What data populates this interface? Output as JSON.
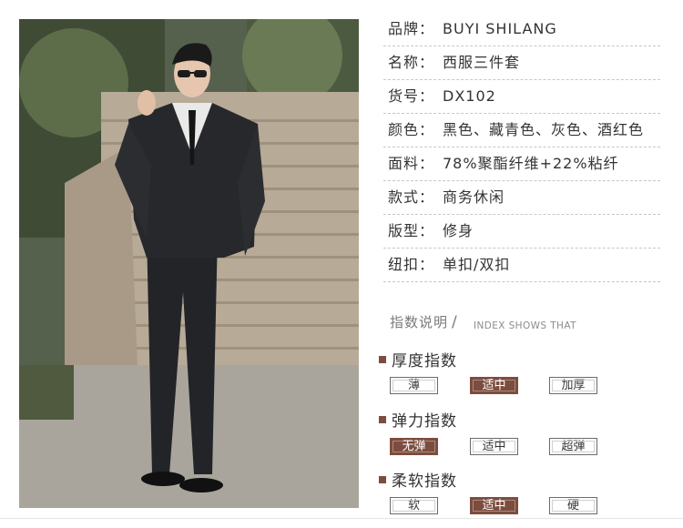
{
  "product": {
    "image_alt": "Man in black three-piece suit with sunglasses on outdoor stone steps",
    "specs": [
      {
        "label": "品牌：",
        "value": "BUYI SHILANG"
      },
      {
        "label": "名称：",
        "value": "西服三件套"
      },
      {
        "label": "货号：",
        "value": "DX102"
      },
      {
        "label": "颜色：",
        "value": "黑色、藏青色、灰色、酒红色"
      },
      {
        "label": "面料：",
        "value": "78%聚酯纤维+22%粘纤"
      },
      {
        "label": "款式：",
        "value": "商务休闲"
      },
      {
        "label": "版型：",
        "value": "修身"
      },
      {
        "label": "纽扣：",
        "value": "单扣/双扣"
      }
    ]
  },
  "index": {
    "title": "指数说明",
    "subtitle": "INDEX SHOWS THAT",
    "groups": [
      {
        "title": "厚度指数",
        "options": [
          "薄",
          "适中",
          "加厚"
        ],
        "selected": 1
      },
      {
        "title": "弹力指数",
        "options": [
          "无弹",
          "适中",
          "超弹"
        ],
        "selected": 0
      },
      {
        "title": "柔软指数",
        "options": [
          "软",
          "适中",
          "硬"
        ],
        "selected": 1
      }
    ]
  },
  "colors": {
    "accent": "#7c4c3e"
  }
}
